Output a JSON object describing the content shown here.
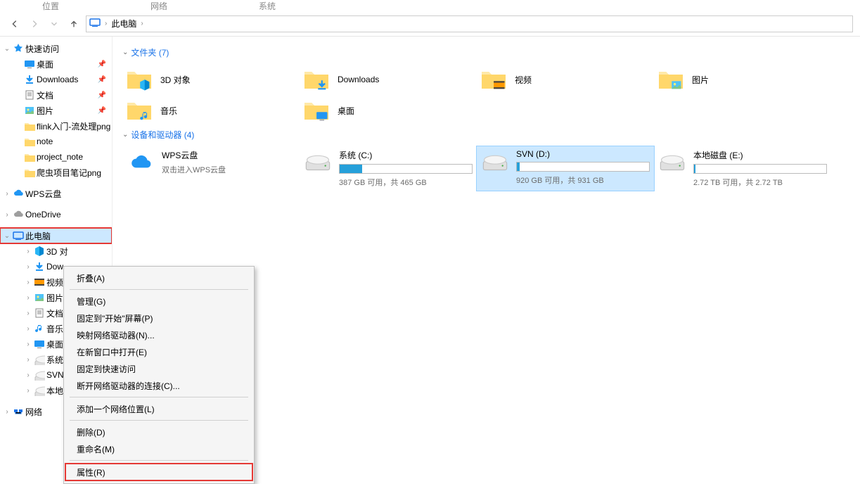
{
  "top_tabs": {
    "a": "位置",
    "b": "网络",
    "c": "系统"
  },
  "breadcrumb": {
    "location": "此电脑"
  },
  "sidebar": {
    "quick_access": "快速访问",
    "pinned": [
      {
        "label": "桌面",
        "icon": "desktop"
      },
      {
        "label": "Downloads",
        "icon": "download"
      },
      {
        "label": "文档",
        "icon": "document"
      },
      {
        "label": "图片",
        "icon": "pictures"
      }
    ],
    "recent": [
      {
        "label": "flink入门-流处理png"
      },
      {
        "label": "note"
      },
      {
        "label": "project_note"
      },
      {
        "label": "爬虫项目笔记png"
      }
    ],
    "wps": "WPS云盘",
    "onedrive": "OneDrive",
    "this_pc": "此电脑",
    "this_pc_children": [
      {
        "label": "3D 对",
        "icon": "3d"
      },
      {
        "label": "Dow",
        "icon": "download"
      },
      {
        "label": "视频",
        "icon": "video"
      },
      {
        "label": "图片",
        "icon": "pictures"
      },
      {
        "label": "文档",
        "icon": "document"
      },
      {
        "label": "音乐",
        "icon": "music"
      },
      {
        "label": "桌面",
        "icon": "desktop"
      },
      {
        "label": "系统",
        "icon": "drive"
      },
      {
        "label": "SVN",
        "icon": "drive"
      },
      {
        "label": "本地",
        "icon": "drive"
      }
    ],
    "network": "网络"
  },
  "content": {
    "folders_header": "文件夹 (7)",
    "folders": [
      {
        "label": "3D 对象",
        "icon": "3d"
      },
      {
        "label": "Downloads",
        "icon": "download"
      },
      {
        "label": "视频",
        "icon": "video"
      },
      {
        "label": "图片",
        "icon": "pictures"
      },
      {
        "label": "音乐",
        "icon": "music"
      },
      {
        "label": "桌面",
        "icon": "desktop"
      }
    ],
    "drives_header": "设备和驱动器 (4)",
    "wps_drive": {
      "label": "WPS云盘",
      "sub": "双击进入WPS云盘"
    },
    "drives": [
      {
        "label": "系统 (C:)",
        "sub": "387 GB 可用，共 465 GB",
        "fill": 17
      },
      {
        "label": "SVN (D:)",
        "sub": "920 GB 可用，共 931 GB",
        "fill": 2,
        "selected": true
      },
      {
        "label": "本地磁盘 (E:)",
        "sub": "2.72 TB 可用，共 2.72 TB",
        "fill": 1
      }
    ]
  },
  "context_menu": {
    "items": [
      {
        "label": "折叠(A)"
      },
      {
        "sep": true
      },
      {
        "label": "管理(G)"
      },
      {
        "label": "固定到\"开始\"屏幕(P)"
      },
      {
        "label": "映射网络驱动器(N)..."
      },
      {
        "label": "在新窗口中打开(E)"
      },
      {
        "label": "固定到快速访问"
      },
      {
        "label": "断开网络驱动器的连接(C)..."
      },
      {
        "sep": true
      },
      {
        "label": "添加一个网络位置(L)"
      },
      {
        "sep": true
      },
      {
        "label": "删除(D)"
      },
      {
        "label": "重命名(M)"
      },
      {
        "sep": true
      },
      {
        "label": "属性(R)",
        "highlight": true
      }
    ]
  }
}
